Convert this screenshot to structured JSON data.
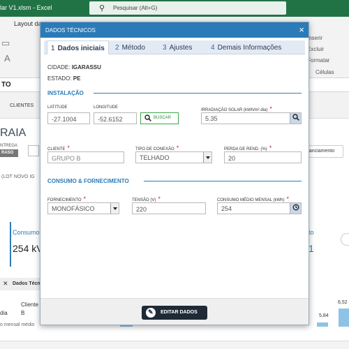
{
  "excel": {
    "title": "lar V1.xlsm  -  Excel",
    "search_placeholder": "Pesquisar (Alt+G)",
    "layout_tab": "Layout da",
    "ribbon_right": [
      "Inserir",
      "Excluir",
      "Formatar"
    ],
    "ribbon_group": "Células",
    "name_box": "TO",
    "clientes_tab": "CLIENTES",
    "big_text": "RAIA",
    "entrega_label": "NTREGA",
    "raso_badge": "RASO",
    "financiamento_btn": "nanciamento",
    "lote_text": "(LOT NOVO IG",
    "card_consumo_title": "Consumo",
    "card_consumo_value": "254 kV",
    "card_right_title": "to",
    "card_right_value": "1",
    "dados_tecnicos_tab": "Dados Técn",
    "dia_text": "dia",
    "cliente_label": "Cliente",
    "cliente_value": "B",
    "mensal_text": "o mensal médio",
    "bar_labels": [
      "5,84",
      "6,52"
    ]
  },
  "modal": {
    "title": "DADOS TÉCNICOS",
    "close_glyph": "×",
    "tabs": [
      {
        "num": "1",
        "label": "Dados iniciais"
      },
      {
        "num": "2",
        "label": "Método"
      },
      {
        "num": "3",
        "label": "Ajustes"
      },
      {
        "num": "4",
        "label": "Demais Informações"
      }
    ],
    "cidade_label": "CIDADE:",
    "cidade_value": "IGARASSU",
    "estado_label": "ESTADO:",
    "estado_value": "PE",
    "section_instalacao": "INSTALAÇÃO",
    "latitude_label": "LATITUDE",
    "latitude_value": "-27.1004",
    "longitude_label": "LONGITUDE",
    "longitude_value": "-52.6152",
    "buscar_label": "BUSCAR",
    "irradiacao_label": "IRRADIAÇÃO SOLAR (kWh/m².dia)",
    "irradiacao_value": "5.35",
    "cliente_label": "CLIENTE",
    "cliente_value": "GRUPO B",
    "conexao_label": "TIPO DE CONEXÃO",
    "conexao_value": "TELHADO",
    "perda_label": "PERDA DE REND. (%)",
    "perda_value": "20",
    "section_consumo": "CONSUMO & FORNECIMENTO",
    "fornecimento_label": "FORNECIMENTO",
    "fornecimento_value": "MONOFÁSICO",
    "tensao_label": "TENSÃO (V)",
    "tensao_value": "220",
    "consumo_label": "CONSUMO MÉDIO MENSAL (kWh)",
    "consumo_value": "254",
    "required_mark": "*",
    "editar_label": "EDITAR DADOS"
  },
  "colors": {
    "excel_green": "#217346",
    "modal_blue": "#2b7bb9",
    "required_red": "#d9232d",
    "buscar_green": "#3aa84a",
    "editar_dark": "#1f2a36"
  },
  "icons": [
    "search-icon",
    "close-icon",
    "chevron-down-icon",
    "history-icon",
    "pencil-icon",
    "wrench-icon"
  ]
}
